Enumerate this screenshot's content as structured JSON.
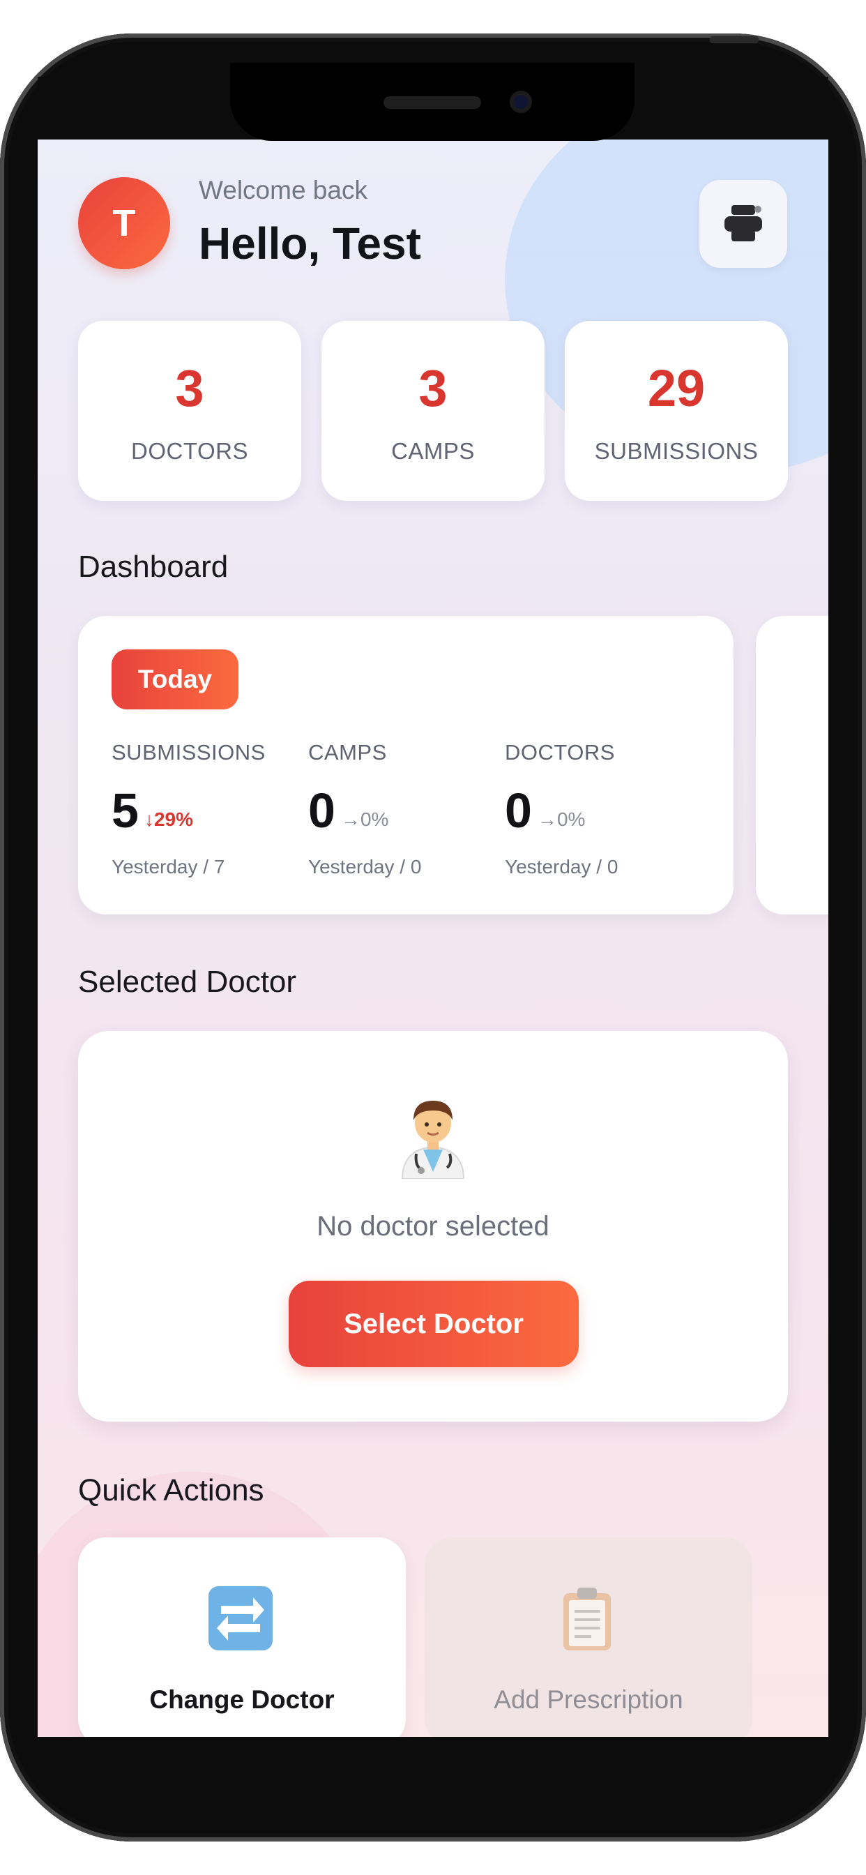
{
  "header": {
    "avatar_initial": "T",
    "welcome": "Welcome back",
    "greeting": "Hello, Test",
    "tool_icon": "printer-icon"
  },
  "stats": [
    {
      "value": "3",
      "label": "DOCTORS"
    },
    {
      "value": "3",
      "label": "CAMPS"
    },
    {
      "value": "29",
      "label": "SUBMISSIONS"
    }
  ],
  "dashboard": {
    "title": "Dashboard",
    "period": "Today",
    "columns": [
      {
        "label": "SUBMISSIONS",
        "value": "5",
        "change": "↓29%",
        "change_color": "#d8362f",
        "sub": "Yesterday / 7"
      },
      {
        "label": "CAMPS",
        "value": "0",
        "change": "→0%",
        "change_color": "#8a8d98",
        "sub": "Yesterday / 0"
      },
      {
        "label": "DOCTORS",
        "value": "0",
        "change": "→0%",
        "change_color": "#8a8d98",
        "sub": "Yesterday / 0"
      }
    ]
  },
  "selected_doctor": {
    "title": "Selected Doctor",
    "icon": "doctor-icon",
    "empty_text": "No doctor selected",
    "button": "Select Doctor"
  },
  "quick_actions": {
    "title": "Quick Actions",
    "items": [
      {
        "label": "Change Doctor",
        "icon": "swap-icon",
        "enabled": true
      },
      {
        "label": "Add Prescription",
        "icon": "clipboard-icon",
        "enabled": false
      }
    ]
  },
  "colors": {
    "accent": "#e8423c",
    "accent_end": "#fb6a3f",
    "stat_number": "#d8362f"
  }
}
